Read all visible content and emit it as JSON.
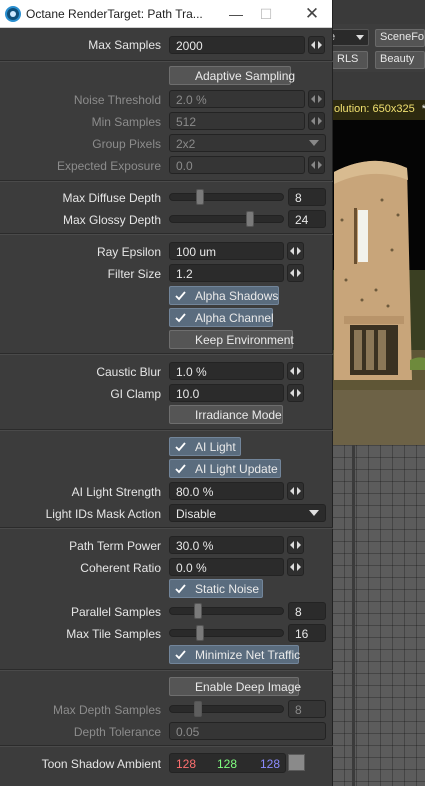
{
  "window": {
    "title": "Octane RenderTarget: Path Tra...",
    "minimize_glyph": "—",
    "maximize_glyph": "☐",
    "close_glyph": "✕"
  },
  "background": {
    "combo_value": "e",
    "scene_button": "SceneFo",
    "rls_button": "RLS",
    "beauty_button": "Beauty",
    "resolution_text": "olution: 650x325",
    "resolution_marker": "*"
  },
  "fields": {
    "max_samples": {
      "label": "Max Samples",
      "value": "2000"
    },
    "noise_threshold": {
      "label": "Noise Threshold",
      "value": "2.0 %"
    },
    "min_samples": {
      "label": "Min Samples",
      "value": "512"
    },
    "group_pixels": {
      "label": "Group Pixels",
      "value": "2x2"
    },
    "expected_exposure": {
      "label": "Expected Exposure",
      "value": "0.0"
    },
    "max_diffuse_depth": {
      "label": "Max Diffuse Depth",
      "value": "8",
      "level": 0.25
    },
    "max_glossy_depth": {
      "label": "Max Glossy Depth",
      "value": "24",
      "level": 0.72
    },
    "ray_epsilon": {
      "label": "Ray Epsilon",
      "value": "100 um"
    },
    "filter_size": {
      "label": "Filter Size",
      "value": "1.2"
    },
    "caustic_blur": {
      "label": "Caustic Blur",
      "value": "1.0 %"
    },
    "gi_clamp": {
      "label": "GI Clamp",
      "value": "10.0"
    },
    "ai_light_strength": {
      "label": "AI Light Strength",
      "value": "80.0 %"
    },
    "light_ids_mask_action": {
      "label": "Light IDs Mask Action",
      "value": "Disable"
    },
    "path_term_power": {
      "label": "Path Term Power",
      "value": "30.0 %"
    },
    "coherent_ratio": {
      "label": "Coherent Ratio",
      "value": "0.0 %"
    },
    "parallel_samples": {
      "label": "Parallel Samples",
      "value": "8",
      "level": 0.23
    },
    "max_tile_samples": {
      "label": "Max Tile Samples",
      "value": "16",
      "level": 0.25
    },
    "max_depth_samples": {
      "label": "Max Depth Samples",
      "value": "8",
      "level": 0.23
    },
    "depth_tolerance": {
      "label": "Depth Tolerance",
      "value": "0.05"
    },
    "toon_shadow_ambient": {
      "label": "Toon Shadow Ambient",
      "r": "128",
      "g": "128",
      "b": "128"
    }
  },
  "toggles": {
    "adaptive_sampling": {
      "label": "Adaptive Sampling",
      "checked": false
    },
    "alpha_shadows": {
      "label": "Alpha Shadows",
      "checked": true
    },
    "alpha_channel": {
      "label": "Alpha Channel",
      "checked": true
    },
    "keep_environment": {
      "label": "Keep Environment",
      "checked": false
    },
    "irradiance_mode": {
      "label": "Irradiance Mode",
      "checked": false
    },
    "ai_light": {
      "label": "AI Light",
      "checked": true
    },
    "ai_light_update": {
      "label": "AI Light Update",
      "checked": true
    },
    "static_noise": {
      "label": "Static Noise",
      "checked": true
    },
    "minimize_net_traffic": {
      "label": "Minimize Net Traffic",
      "checked": true
    },
    "enable_deep_image": {
      "label": "Enable Deep Image",
      "checked": false
    }
  },
  "colors": {
    "red": "#ff7070",
    "green": "#80ff80",
    "blue": "#8c8cff",
    "checked_button": "#5a6c7e",
    "swatch": "#8a8a8a"
  }
}
